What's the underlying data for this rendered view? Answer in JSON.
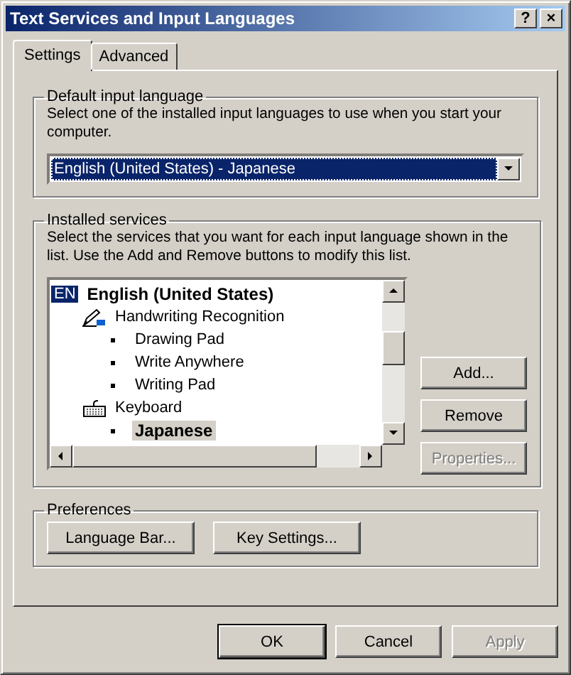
{
  "window": {
    "title": "Text Services and Input Languages",
    "help_button": "?",
    "close_button": "×"
  },
  "tabs": [
    {
      "label": "Settings",
      "selected": true
    },
    {
      "label": "Advanced",
      "selected": false
    }
  ],
  "default_language": {
    "title": "Default input language",
    "description": "Select one of the installed input languages to use when you start your computer.",
    "value": "English (United States) - Japanese"
  },
  "installed_services": {
    "title": "Installed services",
    "description": "Select the services that you want for each input language shown in the list. Use the Add and Remove buttons to modify this list.",
    "tree": [
      {
        "kind": "language",
        "badge": "EN",
        "label": "English (United States)",
        "default": true,
        "selected": false,
        "children": [
          {
            "kind": "handwriting",
            "label": "Handwriting Recognition",
            "default": false,
            "selected": false,
            "children": [
              {
                "kind": "service",
                "label": "Drawing Pad",
                "default": false,
                "selected": false
              },
              {
                "kind": "service",
                "label": "Write Anywhere",
                "default": false,
                "selected": false
              },
              {
                "kind": "service",
                "label": "Writing Pad",
                "default": false,
                "selected": false
              }
            ]
          },
          {
            "kind": "keyboard",
            "label": "Keyboard",
            "default": false,
            "selected": false,
            "children": [
              {
                "kind": "service",
                "label": "Japanese",
                "default": true,
                "selected": true
              }
            ]
          }
        ]
      }
    ],
    "buttons": [
      {
        "label": "Add...",
        "disabled": false
      },
      {
        "label": "Remove",
        "disabled": false
      },
      {
        "label": "Properties...",
        "disabled": true
      }
    ]
  },
  "preferences": {
    "title": "Preferences",
    "buttons": [
      {
        "label": "Language Bar..."
      },
      {
        "label": "Key Settings..."
      }
    ]
  },
  "dialog_buttons": [
    {
      "label": "OK",
      "disabled": false,
      "default": true
    },
    {
      "label": "Cancel",
      "disabled": false,
      "default": false
    },
    {
      "label": "Apply",
      "disabled": true,
      "default": false
    }
  ]
}
